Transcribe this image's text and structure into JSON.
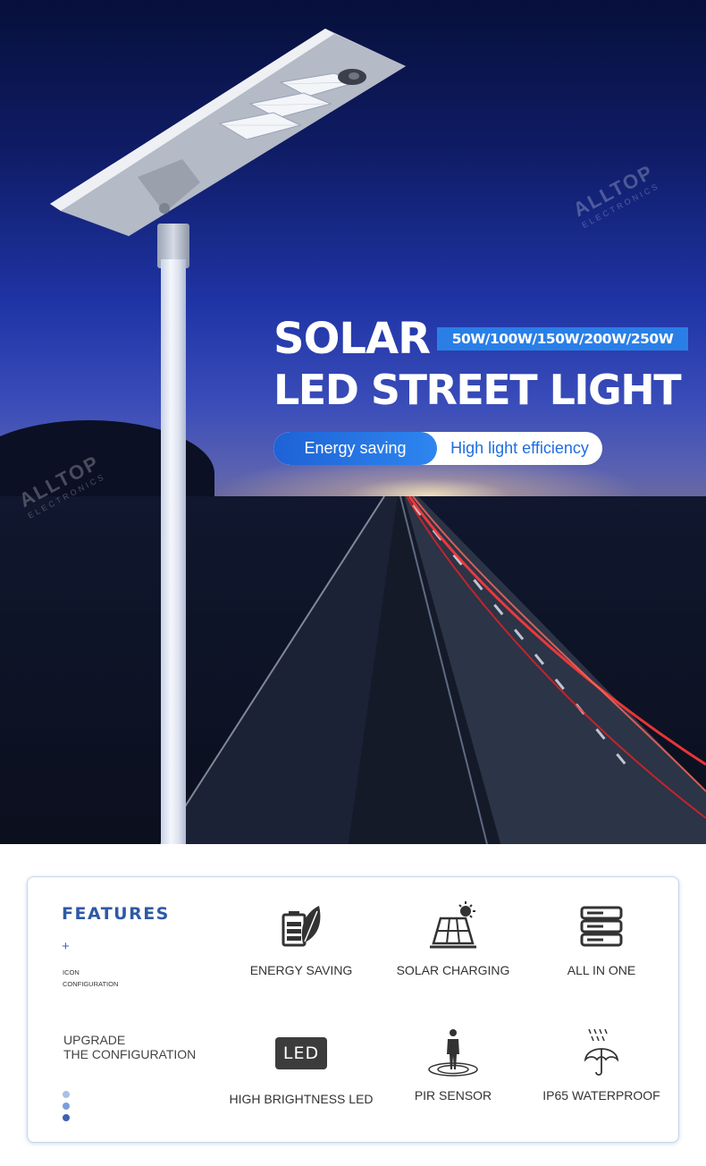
{
  "hero": {
    "title_line1": "SOLAR",
    "wattage": "50W/100W/150W/200W/250W",
    "title_line2": "LED STREET LIGHT",
    "tag_primary": "Energy saving",
    "tag_secondary": "High light efficiency",
    "watermark_brand": "ALLTOP",
    "watermark_sub": "ELECTRONICS"
  },
  "features": {
    "heading": "FEATURES",
    "plus": "+",
    "sub_line1": "ICON",
    "sub_line2": "CONFIGURATION",
    "upgrade_line1": "UPGRADE",
    "upgrade_line2": "THE CONFIGURATION",
    "led_badge": "LED",
    "items": [
      {
        "label": "ENERGY SAVING",
        "icon": "battery-leaf-icon"
      },
      {
        "label": "SOLAR CHARGING",
        "icon": "solar-panel-sun-icon"
      },
      {
        "label": "ALL IN ONE",
        "icon": "stacked-units-icon"
      },
      {
        "label": "HIGH BRIGHTNESS LED",
        "icon": "led-badge-icon"
      },
      {
        "label": "PIR SENSOR",
        "icon": "person-sensor-icon"
      },
      {
        "label": "IP65 WATERPROOF",
        "icon": "umbrella-rain-icon"
      }
    ]
  },
  "colors": {
    "accent_blue": "#2a7fe6",
    "heading_blue": "#2f59a6",
    "dot_light": "#a9c0e6",
    "dot_mid": "#7c9dd6",
    "dot_dark": "#3b63b3"
  }
}
